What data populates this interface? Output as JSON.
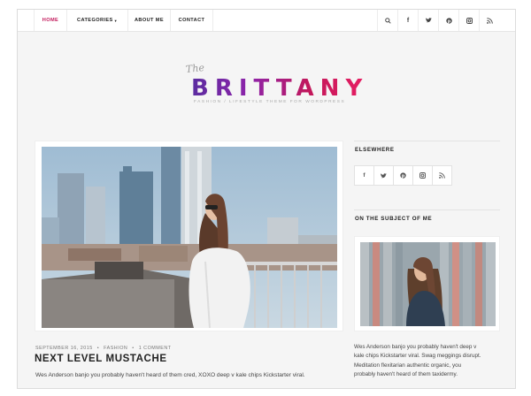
{
  "nav": {
    "items": [
      {
        "label": "HOME",
        "active": true
      },
      {
        "label": "CATEGORIES",
        "has_dropdown": true
      },
      {
        "label": "ABOUT ME"
      },
      {
        "label": "CONTACT"
      }
    ],
    "icons": [
      "search-icon",
      "facebook-icon",
      "twitter-icon",
      "pinterest-icon",
      "instagram-icon",
      "rss-icon"
    ]
  },
  "logo": {
    "prefix": "The",
    "name": "BRITTANY",
    "tagline": "FASHION / LIFESTYLE THEME FOR WORDPRESS"
  },
  "post": {
    "date": "SEPTEMBER 16, 2015",
    "category": "FASHION",
    "comments": "1 COMMENT",
    "title": "NEXT LEVEL MUSTACHE",
    "excerpt": "Wes Anderson banjo you probably haven't heard of them cred, XOXO deep v kale chips Kickstarter viral."
  },
  "sidebar": {
    "elsewhere_title": "ELSEWHERE",
    "social": [
      "facebook-icon",
      "twitter-icon",
      "pinterest-icon",
      "instagram-icon",
      "rss-icon"
    ],
    "about_title": "ON THE SUBJECT OF ME",
    "about_lines": [
      "Wes Anderson banjo you probably haven't deep v",
      "kale chips Kickstarter viral. Swag meggings disrupt.",
      "Meditation flexitarian authentic organic, you",
      "probably haven't heard of them taxidermy."
    ]
  },
  "colors": {
    "accent": "#c2185b",
    "logo_start": "#5b2ca0",
    "logo_end": "#e91e63"
  }
}
